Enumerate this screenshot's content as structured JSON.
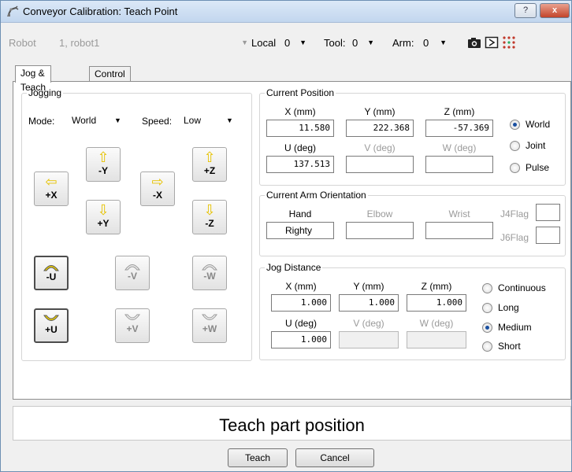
{
  "window": {
    "title": "Conveyor Calibration: Teach Point",
    "help_label": "?",
    "close_label": "x"
  },
  "toolbar": {
    "robot_label": "Robot",
    "robot_value": "1, robot1",
    "local_label": "Local",
    "local_value": "0",
    "tool_label": "Tool:",
    "tool_value": "0",
    "arm_label": "Arm:",
    "arm_value": "0",
    "icons": [
      "camera-icon",
      "run-window-icon",
      "io-monitor-icon"
    ]
  },
  "tabs": [
    {
      "label": "Jog & Teach",
      "active": true
    },
    {
      "label": "Control Panel",
      "active": false
    }
  ],
  "jogging": {
    "title": "Jogging",
    "mode_label": "Mode:",
    "mode_value": "World",
    "speed_label": "Speed:",
    "speed_value": "Low",
    "buttons": {
      "plus_x": "+X",
      "minus_y": "-Y",
      "minus_x": "-X",
      "plus_z": "+Z",
      "plus_y": "+Y",
      "minus_z": "-Z",
      "minus_u": "-U",
      "minus_v": "-V",
      "minus_w": "-W",
      "plus_u": "+U",
      "plus_v": "+V",
      "plus_w": "+W"
    },
    "accent_color": "#f0d000"
  },
  "current_position": {
    "title": "Current Position",
    "labels": {
      "x": "X (mm)",
      "y": "Y (mm)",
      "z": "Z (mm)",
      "u": "U (deg)",
      "v": "V (deg)",
      "w": "W (deg)"
    },
    "values": {
      "x": "11.580",
      "y": "222.368",
      "z": "-57.369",
      "u": "137.513",
      "v": "",
      "w": ""
    },
    "frames": [
      {
        "label": "World",
        "selected": true
      },
      {
        "label": "Joint",
        "selected": false
      },
      {
        "label": "Pulse",
        "selected": false
      }
    ]
  },
  "arm_orientation": {
    "title": "Current Arm Orientation",
    "hand_label": "Hand",
    "hand_value": "Righty",
    "elbow_label": "Elbow",
    "wrist_label": "Wrist",
    "j4flag_label": "J4Flag",
    "j6flag_label": "J6Flag"
  },
  "jog_distance": {
    "title": "Jog Distance",
    "labels": {
      "x": "X (mm)",
      "y": "Y (mm)",
      "z": "Z (mm)",
      "u": "U (deg)",
      "v": "V (deg)",
      "w": "W (deg)"
    },
    "values": {
      "x": "1.000",
      "y": "1.000",
      "z": "1.000",
      "u": "1.000"
    },
    "modes": [
      {
        "label": "Continuous",
        "selected": false
      },
      {
        "label": "Long",
        "selected": false
      },
      {
        "label": "Medium",
        "selected": true
      },
      {
        "label": "Short",
        "selected": false
      }
    ]
  },
  "status_message": "Teach part position",
  "buttons": {
    "teach": "Teach",
    "cancel": "Cancel"
  }
}
